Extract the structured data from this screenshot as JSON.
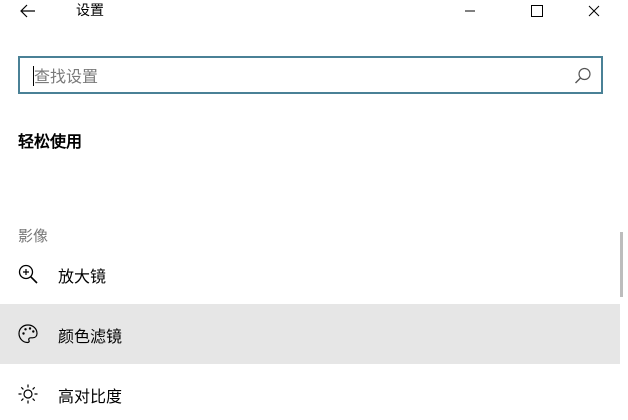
{
  "window": {
    "title": "设置"
  },
  "search": {
    "placeholder": "查找设置"
  },
  "section": {
    "title": "轻松使用"
  },
  "group": {
    "label": "影像"
  },
  "nav": {
    "items": [
      {
        "label": "放大镜",
        "icon": "magnifier-zoom-icon",
        "selected": false
      },
      {
        "label": "颜色滤镜",
        "icon": "color-palette-icon",
        "selected": true
      },
      {
        "label": "高对比度",
        "icon": "brightness-icon",
        "selected": false
      }
    ]
  },
  "colors": {
    "search_border": "#4a8196",
    "selected_bg": "#e6e6e6",
    "group_label": "#767676"
  }
}
